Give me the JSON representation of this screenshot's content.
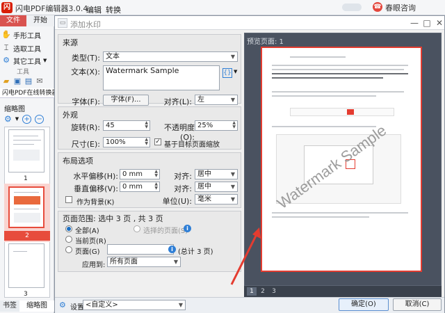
{
  "app": {
    "logo": "闪",
    "title": "闪电PDF编辑器3.0.4",
    "menus": [
      "编辑",
      "转换"
    ],
    "help": "春眼咨询",
    "window_controls": [
      "—",
      "□",
      "✕"
    ]
  },
  "ribbon": {
    "tab_file": "文件",
    "tab_start": "开始"
  },
  "tools": {
    "hand": "手形工具",
    "select": "选取工具",
    "other": "其它工具",
    "group_label": "工具",
    "doc_tab": "闪电PDF在线转换器"
  },
  "thumbnails": {
    "title": "缩略图",
    "pages": [
      "1",
      "2",
      "3"
    ],
    "selected": 1
  },
  "bottom_tabs": [
    "书签",
    "缩略图"
  ],
  "dialog": {
    "title": "添加水印",
    "source": {
      "section": "来源",
      "type_label": "类型(T):",
      "type_value": "文本",
      "text_label": "文本(X):",
      "text_value": "Watermark Sample",
      "font_label": "字体(F):",
      "font_button": "字体(F)...",
      "align_label": "对齐(L):",
      "align_value": "左"
    },
    "appearance": {
      "section": "外观",
      "rotate_label": "旋转(R):",
      "rotate_value": "45",
      "opacity_label": "不透明度(O):",
      "opacity_value": "25%",
      "size_label": "尺寸(E):",
      "size_value": "100%",
      "scale_label": "基于目标页面缩放",
      "scale_checked": true
    },
    "layout": {
      "section": "布局选项",
      "hoffset_label": "水平偏移(H):",
      "hoffset_value": "0 mm",
      "voffset_label": "垂直偏移(V):",
      "voffset_value": "0 mm",
      "halign_label": "对齐:",
      "halign_value": "居中",
      "valign_label": "对齐:",
      "valign_value": "居中",
      "background_label": "作为背景(K)",
      "unit_label": "单位(U):",
      "unit_value": "毫米"
    },
    "range": {
      "section": "页面范围: 选中 3 页 , 共 3 页",
      "all_label": "全部(A)",
      "selected_label": "选择的页面(S)",
      "current_label": "当前页(R)",
      "pages_label": "页面(G)",
      "pages_value": "",
      "total": "(总计 3 页)",
      "apply_label": "应用到:",
      "apply_value": "所有页面"
    },
    "preview": {
      "title": "预览页面: 1",
      "watermark": "Watermark Sample",
      "tabs": [
        "1",
        "2",
        "3"
      ]
    },
    "footer": {
      "settings_label": "设置:",
      "settings_value": "<自定义>",
      "ok": "确定(O)",
      "cancel": "取消(C)"
    }
  },
  "colors": {
    "accent_red": "#e43c30",
    "info_blue": "#2f7fd6",
    "preview_bg": "#4a5260"
  }
}
